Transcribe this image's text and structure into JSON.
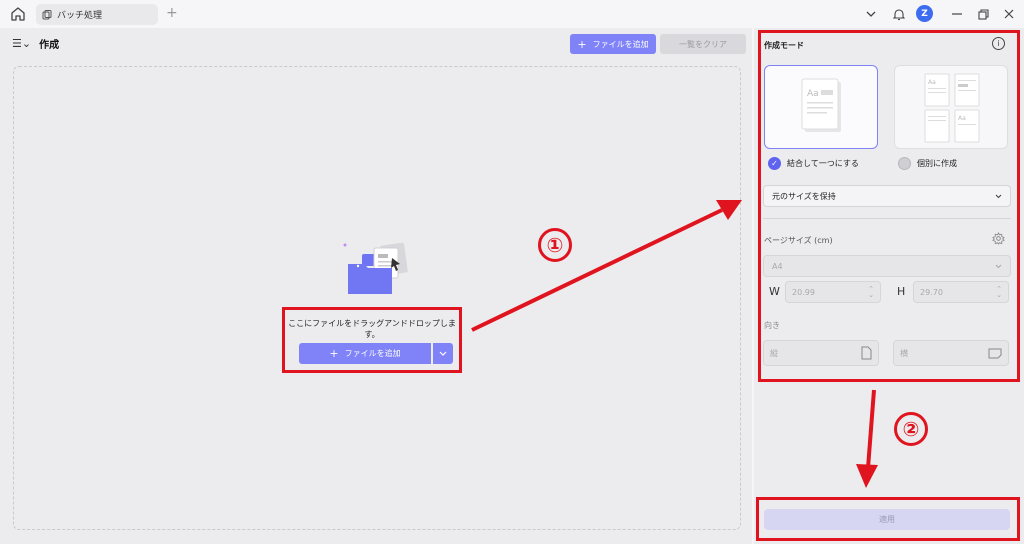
{
  "titlebar": {
    "tab_label": "バッチ処理",
    "avatar_letter": "Z"
  },
  "main": {
    "title": "作成",
    "add_files_button": "ファイルを追加",
    "clear_list_button": "一覧をクリア",
    "drop_text": "ここにファイルをドラッグアンドドロップします。",
    "add_file_button": "ファイルを追加"
  },
  "panel": {
    "title": "作成モード",
    "mode_merge_label": "結合して一つにする",
    "mode_separate_label": "個別に作成",
    "size_select": "元のサイズを保持",
    "page_size_label": "ページサイズ",
    "page_size_unit": "(cm)",
    "paper_select": "A4",
    "width_label": "W",
    "width_value": "20.99",
    "height_label": "H",
    "height_value": "29.70",
    "orientation_label": "向き",
    "portrait_label": "縦",
    "landscape_label": "横",
    "apply_button": "適用"
  },
  "annotations": {
    "step1": "①",
    "step2": "②",
    "color": "#e0141e"
  },
  "colors": {
    "accent": "#7f83f7",
    "radio_checked": "#5e63f0"
  }
}
